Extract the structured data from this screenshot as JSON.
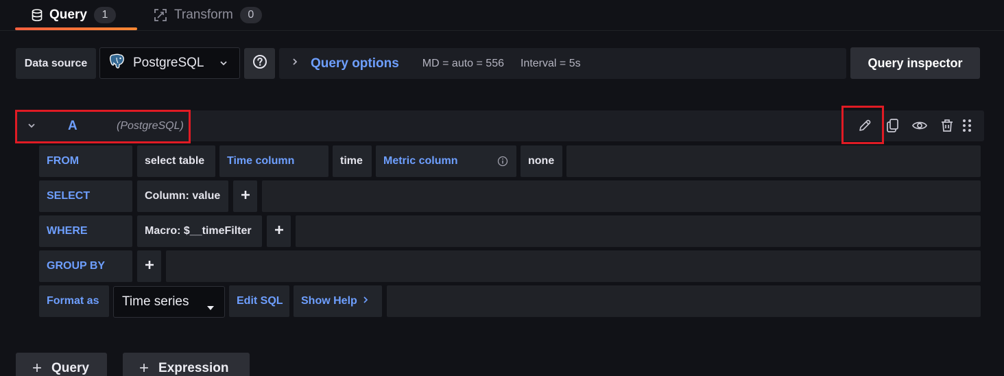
{
  "tabs": [
    {
      "label": "Query",
      "count": "1",
      "icon": "database-icon"
    },
    {
      "label": "Transform",
      "count": "0",
      "icon": "transform-icon"
    }
  ],
  "datasource": {
    "label": "Data source",
    "selected": "PostgreSQL",
    "icon": "postgresql-elephant-icon"
  },
  "query_options": {
    "title": "Query options",
    "md": "MD = auto = 556",
    "interval": "Interval = 5s"
  },
  "inspector_label": "Query inspector",
  "query": {
    "ref_id": "A",
    "datasource_name": "(PostgreSQL)",
    "header_icons": [
      "pencil-edit-icon",
      "duplicate-icon",
      "eye-icon",
      "trash-icon",
      "drag-handle-icon"
    ]
  },
  "editor": {
    "from": {
      "keyword": "FROM",
      "table": "select table",
      "time_column_label": "Time column",
      "time_column_value": "time",
      "metric_column_label": "Metric column",
      "metric_column_value": "none"
    },
    "select": {
      "keyword": "SELECT",
      "column": "Column: value"
    },
    "where": {
      "keyword": "WHERE",
      "macro": "Macro: $__timeFilter"
    },
    "group_by": {
      "keyword": "GROUP BY"
    },
    "format": {
      "keyword": "Format as",
      "value": "Time series",
      "edit_sql": "Edit SQL",
      "show_help": "Show Help"
    }
  },
  "add_buttons": {
    "query": "Query",
    "expression": "Expression"
  },
  "colors": {
    "accent_blue": "#6e9fff",
    "highlight_red": "#e01b24",
    "tab_underline": "#f55f3e"
  }
}
